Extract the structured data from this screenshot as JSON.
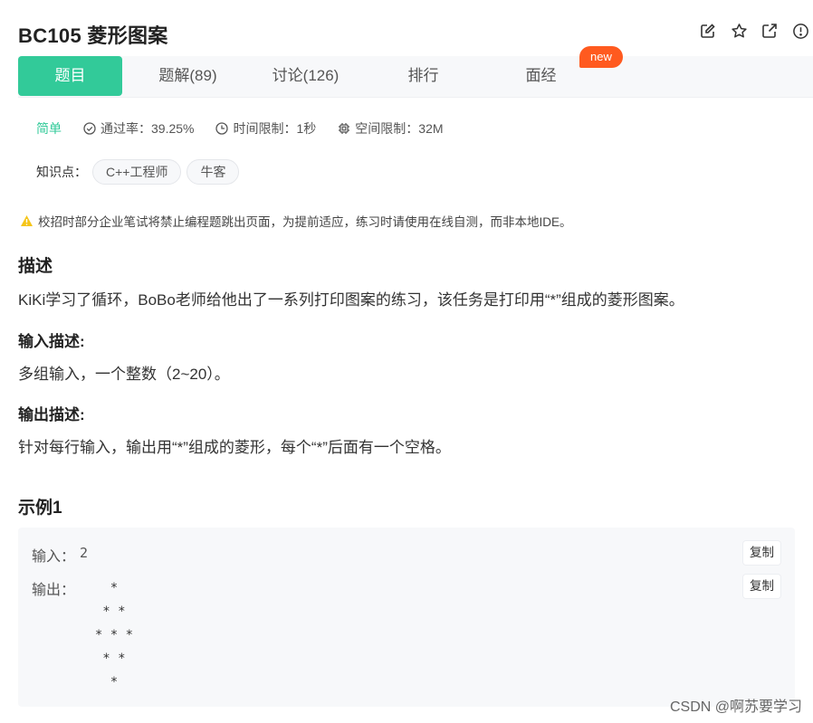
{
  "problem": {
    "title": "BC105  菱形图案",
    "actions": [
      "edit-icon",
      "star-icon",
      "share-icon",
      "report-icon"
    ]
  },
  "tabs": [
    {
      "label": "题目",
      "active": true
    },
    {
      "label": "题解(89)"
    },
    {
      "label": "讨论(126)"
    },
    {
      "label": "排行"
    },
    {
      "label": "面经",
      "badge": "new"
    }
  ],
  "meta": {
    "difficulty": "简单",
    "pass_rate": "通过率：39.25%",
    "time_limit": "时间限制：1秒",
    "space_limit": "空间限制：32M"
  },
  "knowledge": {
    "label": "知识点：",
    "tags": [
      "C++工程师",
      "牛客"
    ]
  },
  "warning": "校招时部分企业笔试将禁止编程题跳出页面，为提前适应，练习时请使用在线自测，而非本地IDE。",
  "description": {
    "heading": "描述",
    "text": "KiKi学习了循环，BoBo老师给他出了一系列打印图案的练习，该任务是打印用“*”组成的菱形图案。"
  },
  "input_desc": {
    "heading": "输入描述:",
    "text": "多组输入，一个整数（2~20）。"
  },
  "output_desc": {
    "heading": "输出描述:",
    "text": "针对每行输入，输出用“*”组成的菱形，每个“*”后面有一个空格。"
  },
  "example": {
    "heading": "示例1",
    "input_label": "输入：",
    "input_value": "2",
    "output_label": "输出：",
    "output_value": "    * \n   * * \n  * * * \n   * * \n    * ",
    "copy_label": "复制"
  },
  "watermark": "CSDN @啊苏要学习",
  "colors": {
    "accent": "#32ca99",
    "new_badge": "#ff5a1f",
    "warning": "#f5c518"
  }
}
